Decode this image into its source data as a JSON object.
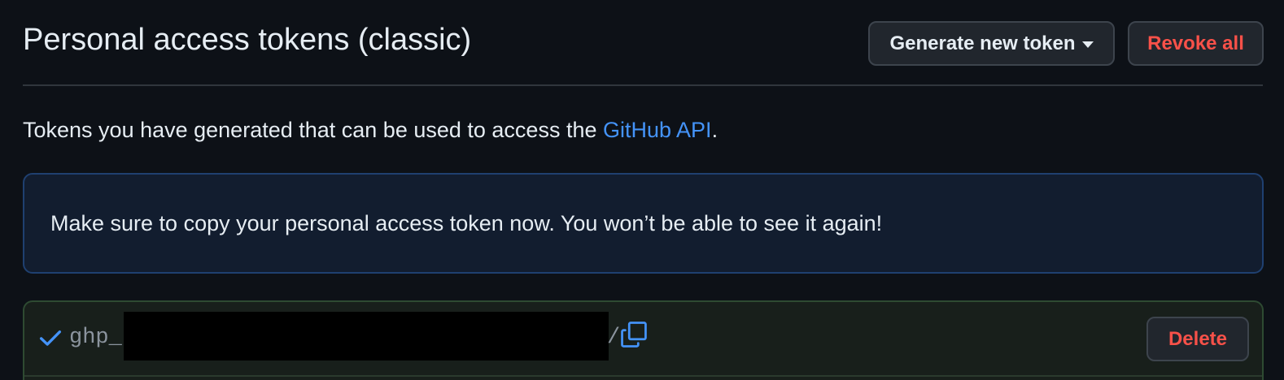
{
  "header": {
    "title": "Personal access tokens (classic)",
    "generate_button_label": "Generate new token",
    "revoke_button_label": "Revoke all"
  },
  "intro": {
    "text_before_link": "Tokens you have generated that can be used to access the ",
    "link_text": "GitHub API",
    "text_after_link": "."
  },
  "flash": {
    "message": "Make sure to copy your personal access token now. You won’t be able to see it again!"
  },
  "token": {
    "prefix": "ghp_",
    "suffix_visible": "/",
    "status_icon": "check-icon",
    "copy_icon": "copy-icon",
    "delete_button_label": "Delete"
  },
  "colors": {
    "background": "#0d1117",
    "text": "#e6edf3",
    "link": "#4493f8",
    "danger": "#f85149",
    "flash_border": "#1f4070",
    "flash_bg": "#121d2f",
    "success_bg": "#181f1b"
  }
}
